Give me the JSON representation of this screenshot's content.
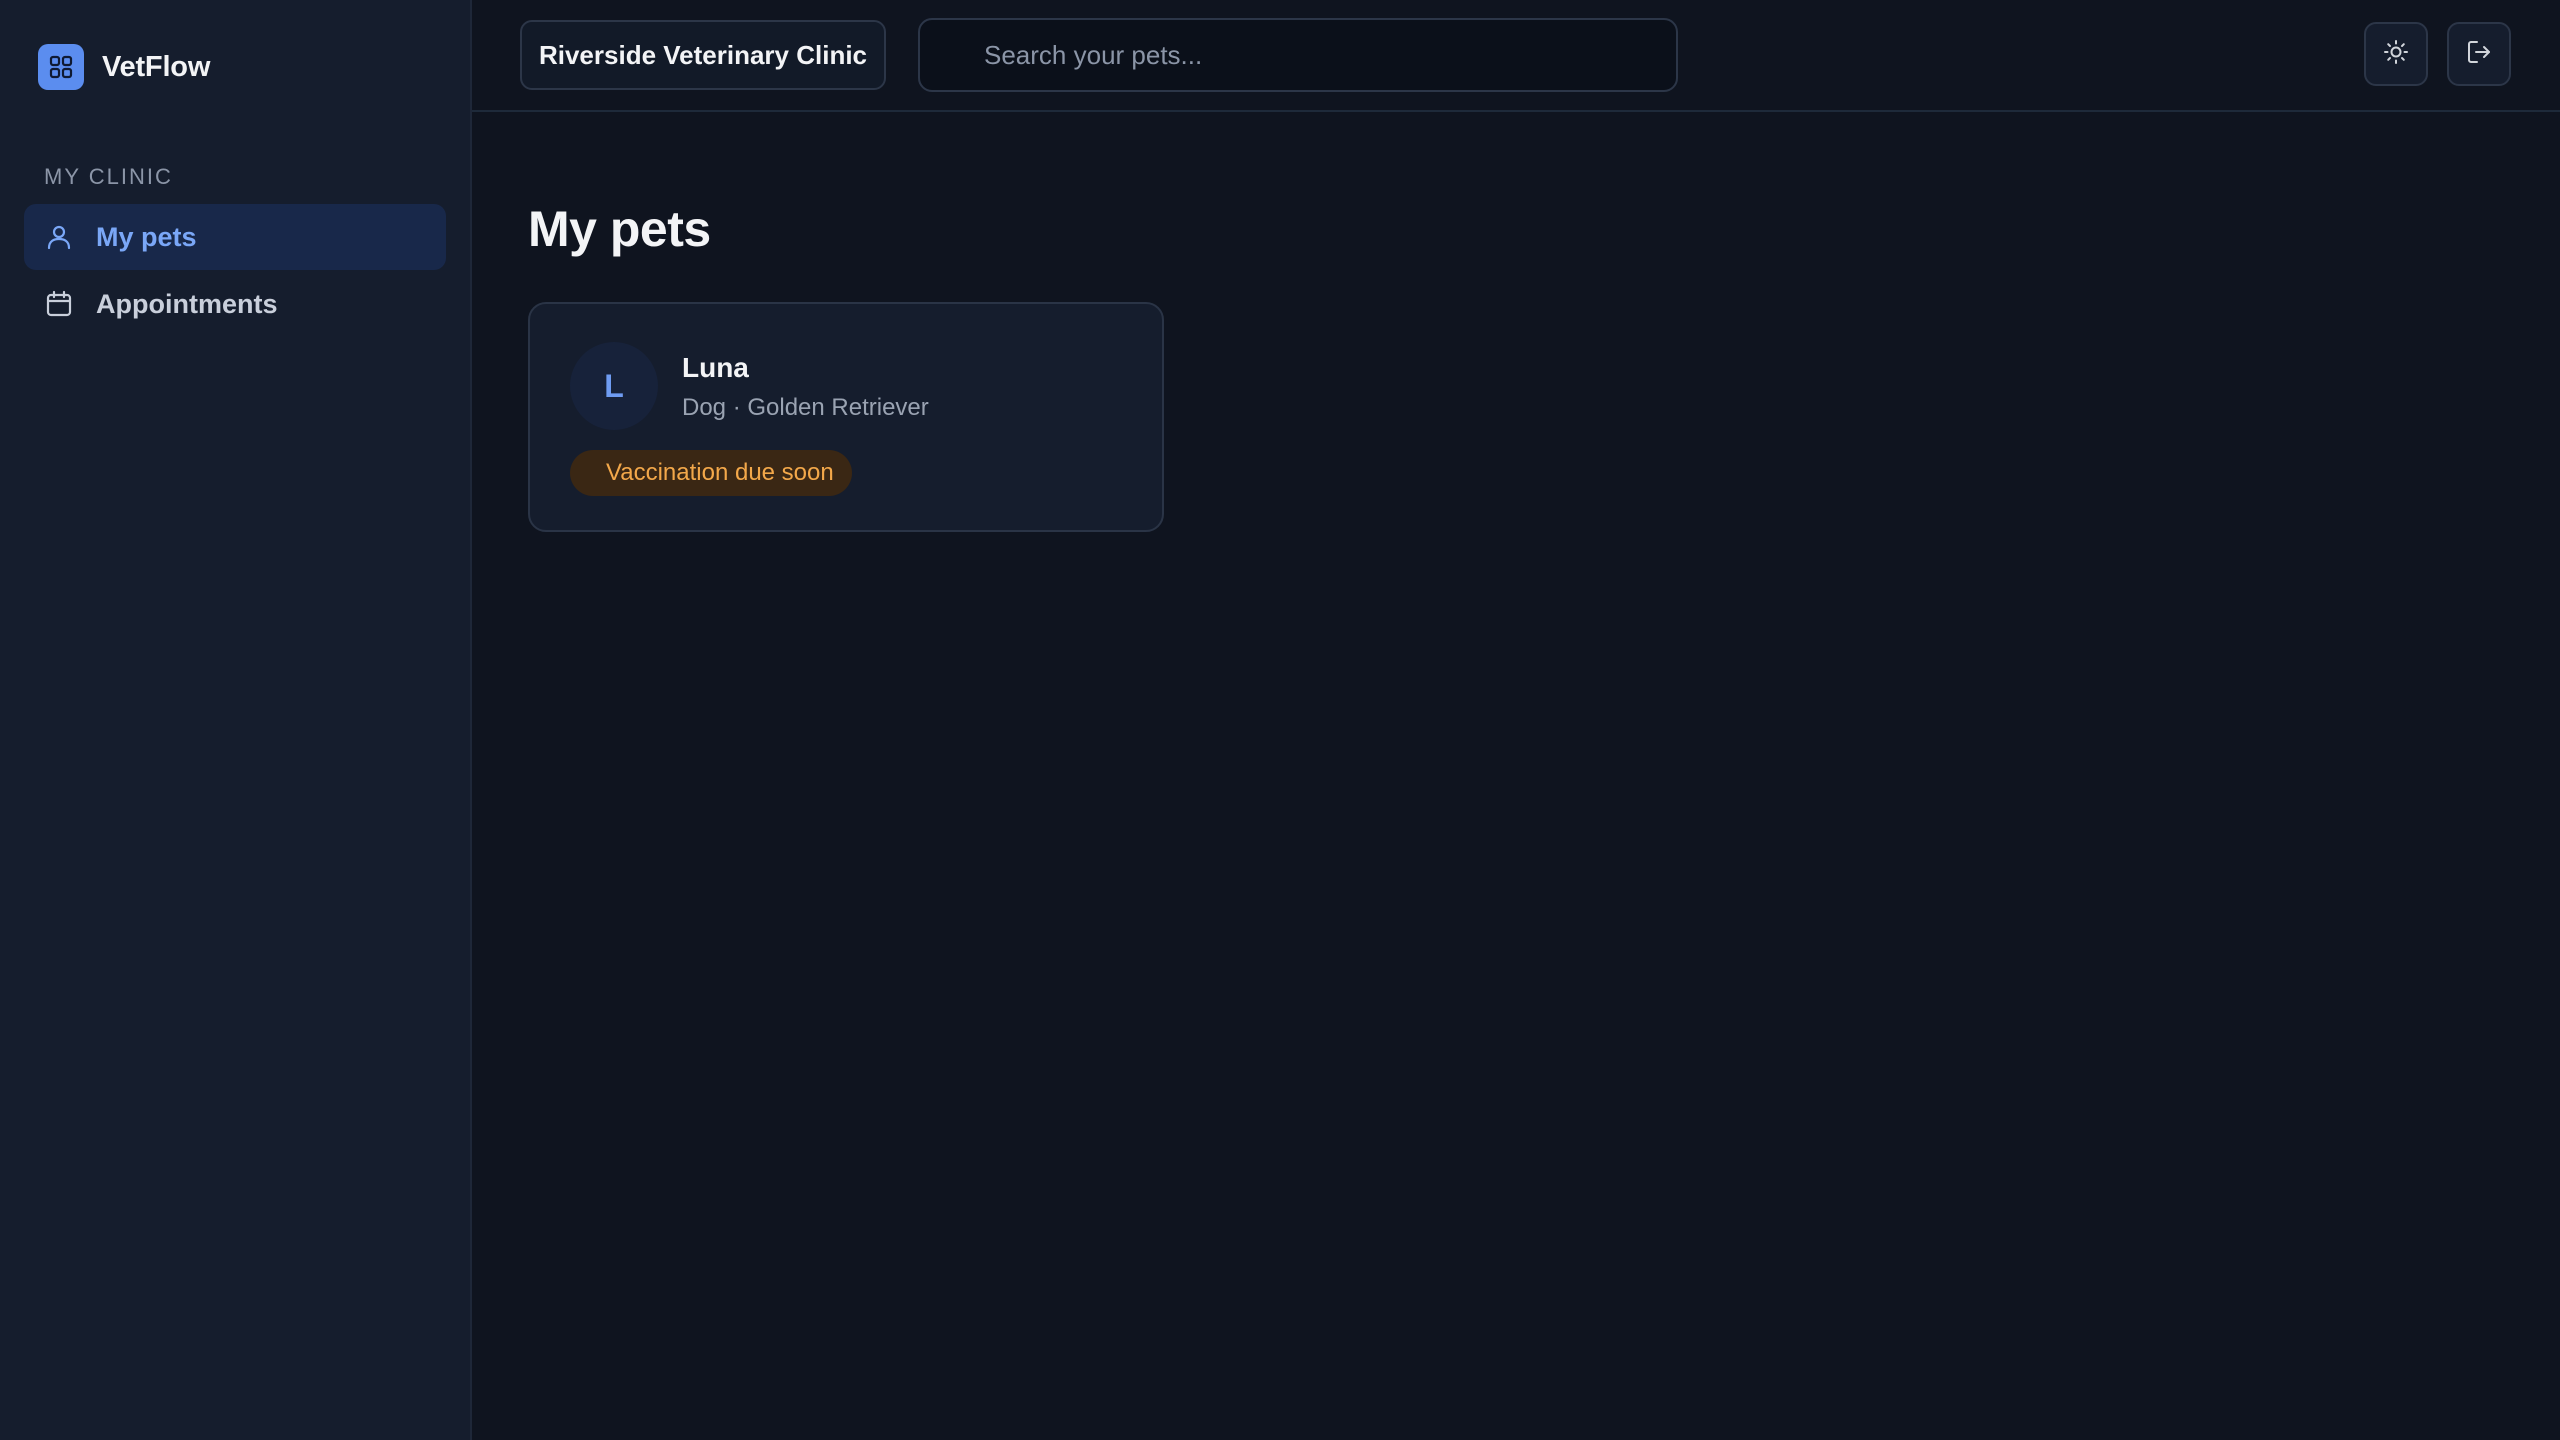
{
  "brand": {
    "name": "VetFlow",
    "icon": "grid-icon",
    "accent": "#5b8def"
  },
  "sidebar": {
    "section_label": "MY CLINIC",
    "items": [
      {
        "label": "My pets",
        "icon": "user-icon",
        "active": true
      },
      {
        "label": "Appointments",
        "icon": "calendar-icon",
        "active": false
      }
    ]
  },
  "topbar": {
    "clinic_label": "Riverside Veterinary Clinic",
    "search": {
      "placeholder": "Search your pets...",
      "value": ""
    },
    "theme_toggle_icon": "sun-icon",
    "logout_icon": "logout-icon"
  },
  "main": {
    "title": "My pets",
    "pets": [
      {
        "initial": "L",
        "name": "Luna",
        "meta": "Dog · Golden Retriever",
        "badge": "Vaccination due soon",
        "badge_color": "#f3a84a"
      }
    ]
  }
}
